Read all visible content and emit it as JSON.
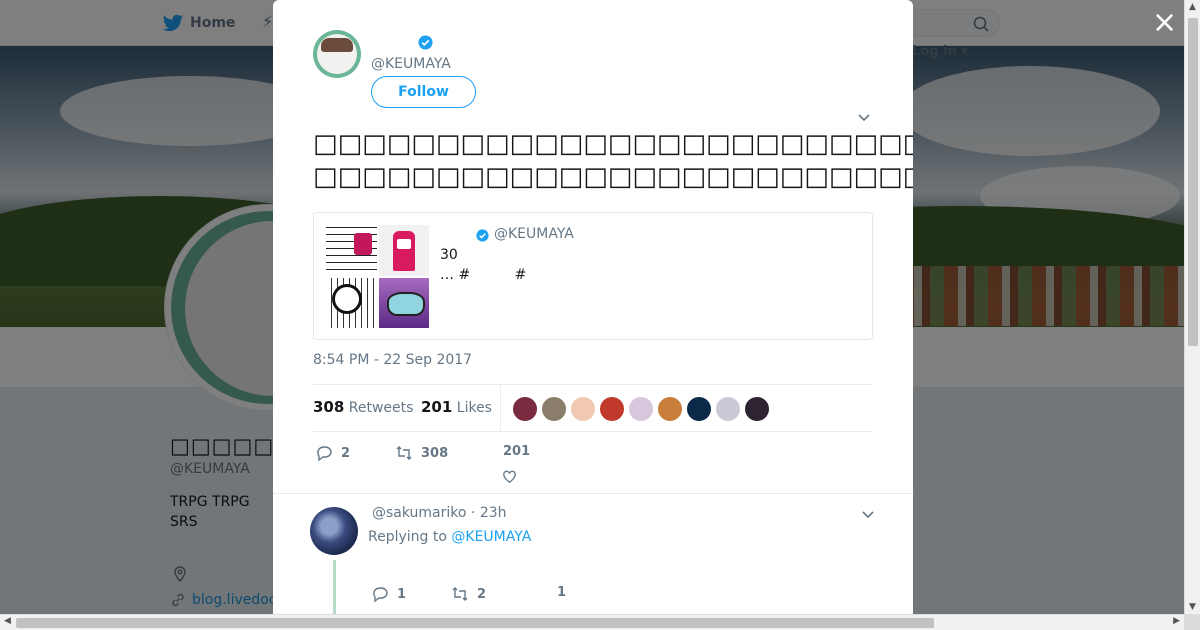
{
  "nav": {
    "home_label": "Home",
    "login_label": "Log in"
  },
  "profile": {
    "name": "□□□□□□□□□",
    "handle": "@KEUMAYA",
    "bio_line1": "TRPG TRPG",
    "bio_line2": "SRS",
    "link_text": "blog.livedoor"
  },
  "modal": {
    "close_glyph": "×",
    "author_handle": "@KEUMAYA",
    "follow_label": "Follow",
    "tweet_line1": "□□□□□□□□□□□□□□□□□□□□□□□□□□□□□□□□□□□□□□□□",
    "tweet_line2": "□□□□□□□□□□□□□□□□□□□□□□□□□□□□□□□□□□□□□",
    "quote": {
      "handle": "@KEUMAYA",
      "line1": "30",
      "line2": "… #          #"
    },
    "timestamp": "8:54 PM - 22 Sep 2017",
    "retweets_count": "308",
    "retweets_label": "Retweets",
    "likes_count": "201",
    "likes_label": "Likes",
    "liker_colors": [
      "#7a2b3f",
      "#8b7d6b",
      "#f1c9b3",
      "#c0392b",
      "#d8c6dd",
      "#c97d3a",
      "#0b2a4a",
      "#c9cad6",
      "#2e2330"
    ],
    "actions": {
      "reply_count": "2",
      "retweet_count": "308",
      "like_count": "201"
    }
  },
  "reply": {
    "handle": "@sakumariko",
    "time": "· 23h",
    "replying_prefix": "Replying to",
    "replying_to": "@KEUMAYA",
    "reply_count": "1",
    "retweet_count": "2",
    "like_count": "1"
  },
  "colors": {
    "brand": "#1da1f2",
    "avatar_ring": "#6bb598"
  }
}
